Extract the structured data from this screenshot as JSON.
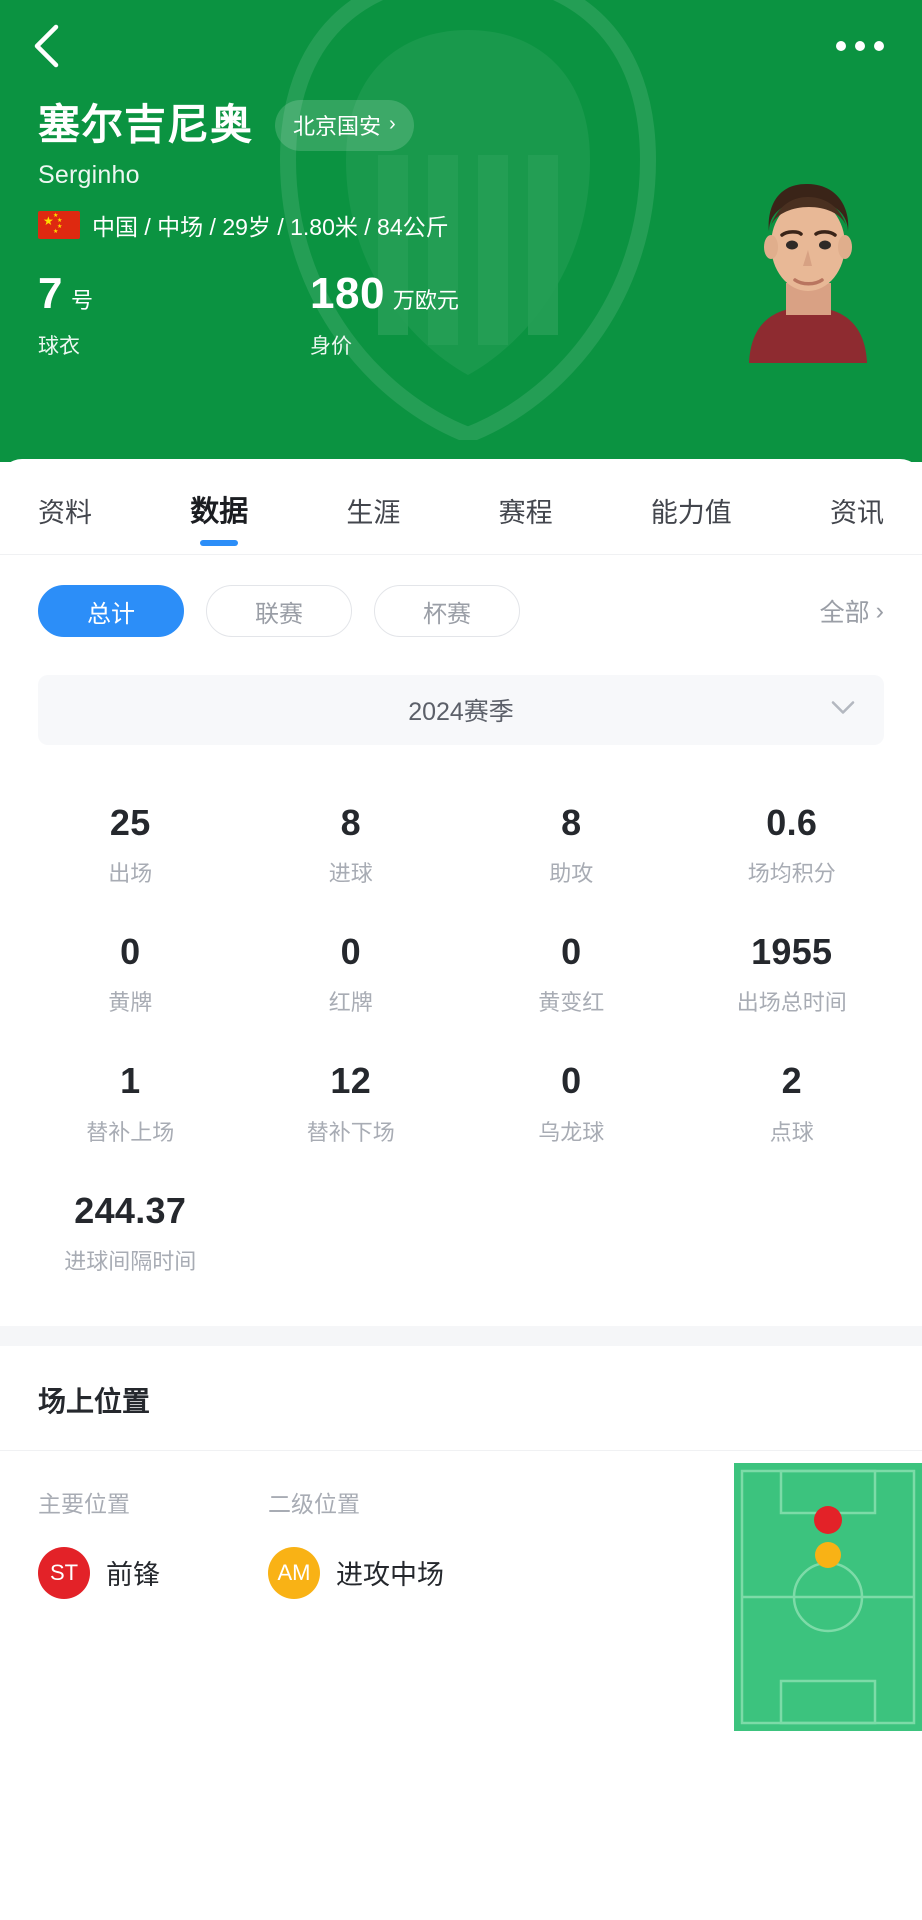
{
  "header": {
    "back_icon": "chevron-left-icon",
    "more_icon": "more-horizontal-icon",
    "player_name": "塞尔吉尼奥",
    "team_chip_label": "北京国安",
    "team_chip_chevron": "›",
    "player_alias": "Serginho",
    "flag_icon": "china-flag-icon",
    "meta_line": "中国 / 中场 / 29岁 / 1.80米 / 84公斤",
    "kpis": [
      {
        "value": "7",
        "unit": "号",
        "label": "球衣"
      },
      {
        "value": "180",
        "unit": "万欧元",
        "label": "身价"
      }
    ],
    "portrait": "player-photo"
  },
  "tabs": [
    {
      "label": "资料",
      "active": false
    },
    {
      "label": "数据",
      "active": true
    },
    {
      "label": "生涯",
      "active": false
    },
    {
      "label": "赛程",
      "active": false
    },
    {
      "label": "能力值",
      "active": false
    },
    {
      "label": "资讯",
      "active": false
    }
  ],
  "filters": {
    "chips": [
      {
        "label": "总计",
        "active": true
      },
      {
        "label": "联赛",
        "active": false
      },
      {
        "label": "杯赛",
        "active": false
      }
    ],
    "all_label": "全部",
    "all_chevron": "›"
  },
  "season": {
    "label": "2024赛季",
    "chevron_icon": "chevron-down-icon"
  },
  "stats": [
    {
      "value": "25",
      "label": "出场"
    },
    {
      "value": "8",
      "label": "进球"
    },
    {
      "value": "8",
      "label": "助攻"
    },
    {
      "value": "0.6",
      "label": "场均积分"
    },
    {
      "value": "0",
      "label": "黄牌"
    },
    {
      "value": "0",
      "label": "红牌"
    },
    {
      "value": "0",
      "label": "黄变红"
    },
    {
      "value": "1955",
      "label": "出场总时间"
    },
    {
      "value": "1",
      "label": "替补上场"
    },
    {
      "value": "12",
      "label": "替补下场"
    },
    {
      "value": "0",
      "label": "乌龙球"
    },
    {
      "value": "2",
      "label": "点球"
    },
    {
      "value": "244.37",
      "label": "进球间隔时间"
    }
  ],
  "position_section": {
    "title": "场上位置",
    "primary": {
      "head": "主要位置",
      "code": "ST",
      "name": "前锋",
      "color": "#e32228"
    },
    "secondary": {
      "head": "二级位置",
      "code": "AM",
      "name": "进攻中场",
      "color": "#f9b215"
    },
    "pitch": {
      "icon": "football-pitch-icon",
      "field_color": "#3cc37e",
      "line_color": "#7ddba8",
      "markers": [
        {
          "code": "ST",
          "color": "#e32228",
          "x": 50,
          "y": 22
        },
        {
          "code": "AM",
          "color": "#f9b215",
          "x": 50,
          "y": 35
        }
      ]
    }
  },
  "colors": {
    "brand_green": "#0b9341",
    "accent_blue": "#2c8ef8",
    "muted": "#a8acb4"
  }
}
